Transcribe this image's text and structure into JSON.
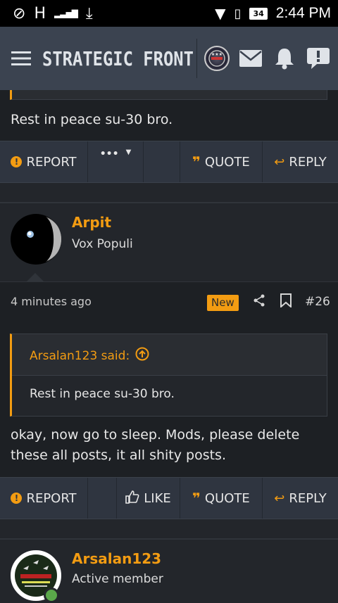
{
  "status_bar": {
    "time": "2:44 PM",
    "battery": "34",
    "network": "H"
  },
  "header": {
    "title": "STRATEGIC FRONT",
    "icons": [
      "menu-icon",
      "mail-icon",
      "bell-icon",
      "alert-icon"
    ]
  },
  "post1": {
    "text": "Rest in peace su-30 bro.",
    "actions": {
      "report": "REPORT",
      "more": "•••",
      "quote": "QUOTE",
      "reply": "REPLY"
    }
  },
  "post2": {
    "username": "Arpit",
    "user_title": "Vox Populi",
    "time": "4 minutes ago",
    "badge": "New",
    "post_number": "#26",
    "quote_author": "Arsalan123 said:",
    "quote_text": "Rest in peace su-30 bro.",
    "text_line1": "okay, now go to sleep. Mods, please delete",
    "text_line2": "these all posts, it all shity posts.",
    "actions": {
      "report": "REPORT",
      "like": "LIKE",
      "quote": "QUOTE",
      "reply": "REPLY"
    }
  },
  "post3": {
    "username": "Arsalan123",
    "user_title": "Active member"
  },
  "colors": {
    "accent": "#f39c12",
    "header_bg": "#3b4350",
    "body_bg": "#1d2024"
  }
}
